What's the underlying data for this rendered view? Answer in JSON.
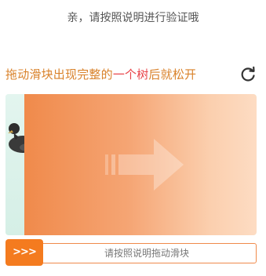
{
  "header": {
    "prompt": "亲，请按照说明进行验证哦"
  },
  "captcha": {
    "instruction_pre": "拖动滑块出现完整的",
    "instruction_highlight": "一个树",
    "instruction_post": "后就松开",
    "slider_hint": "请按照说明拖动滑块",
    "handle_label": ">>>"
  },
  "colors": {
    "accent": "#f47b1f",
    "instruction_text": "#d9822b",
    "highlight_text": "#e8454a"
  },
  "icons": {
    "refresh": "refresh-icon",
    "arrow": "arrow-right-icon",
    "handle": "chevrons-right-icon"
  }
}
